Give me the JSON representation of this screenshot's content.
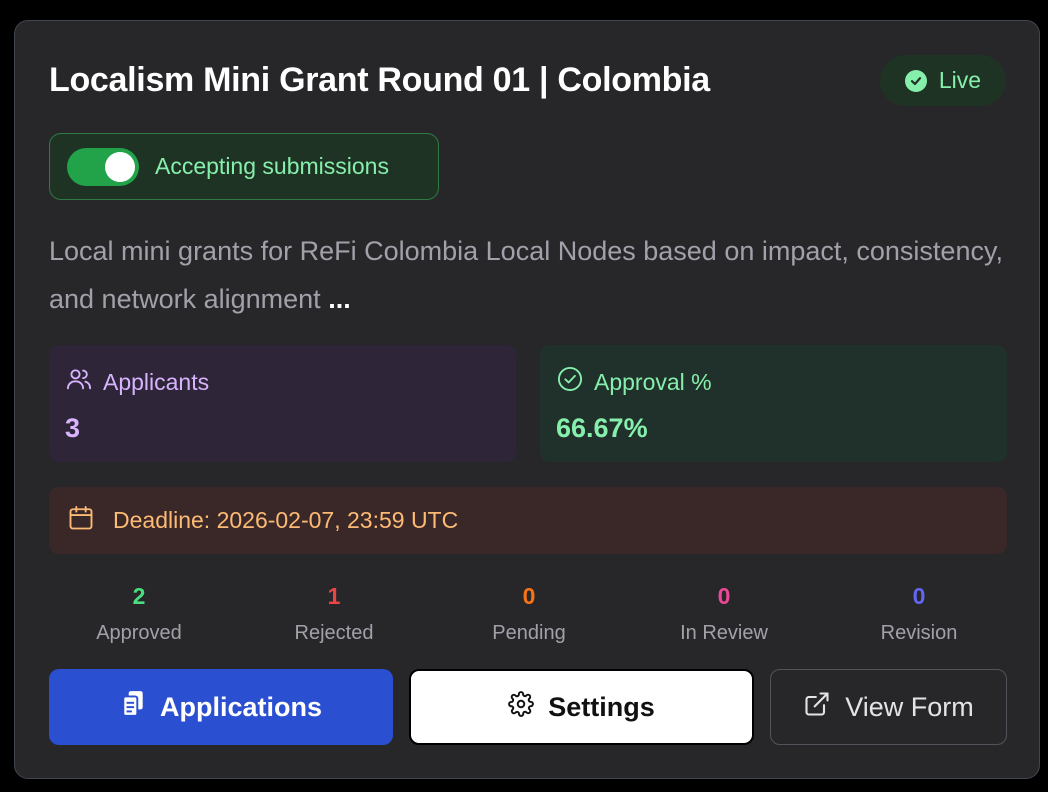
{
  "card": {
    "title": "Localism Mini Grant Round 01 | Colombia",
    "status_badge": {
      "label": "Live",
      "color": "#86efac",
      "icon": "check-circle-icon"
    },
    "accepting_toggle": {
      "label": "Accepting submissions",
      "checked": true,
      "color": "#22a34a"
    },
    "description": {
      "text": "Local mini grants for ReFi Colombia Local Nodes based on impact, consistency, and network alignment",
      "more": "..."
    },
    "stats": {
      "applicants": {
        "label": "Applicants",
        "value": "3",
        "icon": "users-icon"
      },
      "approval": {
        "label": "Approval %",
        "value": "66.67%",
        "icon": "check-circle-icon"
      }
    },
    "deadline": {
      "text": "Deadline: 2026-02-07, 23:59 UTC",
      "icon": "calendar-icon"
    },
    "counts": [
      {
        "value": "2",
        "label": "Approved",
        "color": "#4ade80"
      },
      {
        "value": "1",
        "label": "Rejected",
        "color": "#ef4444"
      },
      {
        "value": "0",
        "label": "Pending",
        "color": "#f97316"
      },
      {
        "value": "0",
        "label": "In Review",
        "color": "#ec4899"
      },
      {
        "value": "0",
        "label": "Revision",
        "color": "#6366f1"
      }
    ],
    "buttons": {
      "applications": {
        "label": "Applications",
        "icon": "clipboard-icon"
      },
      "settings": {
        "label": "Settings",
        "icon": "gear-icon"
      },
      "view_form": {
        "label": "View Form",
        "icon": "external-link-icon"
      }
    }
  }
}
